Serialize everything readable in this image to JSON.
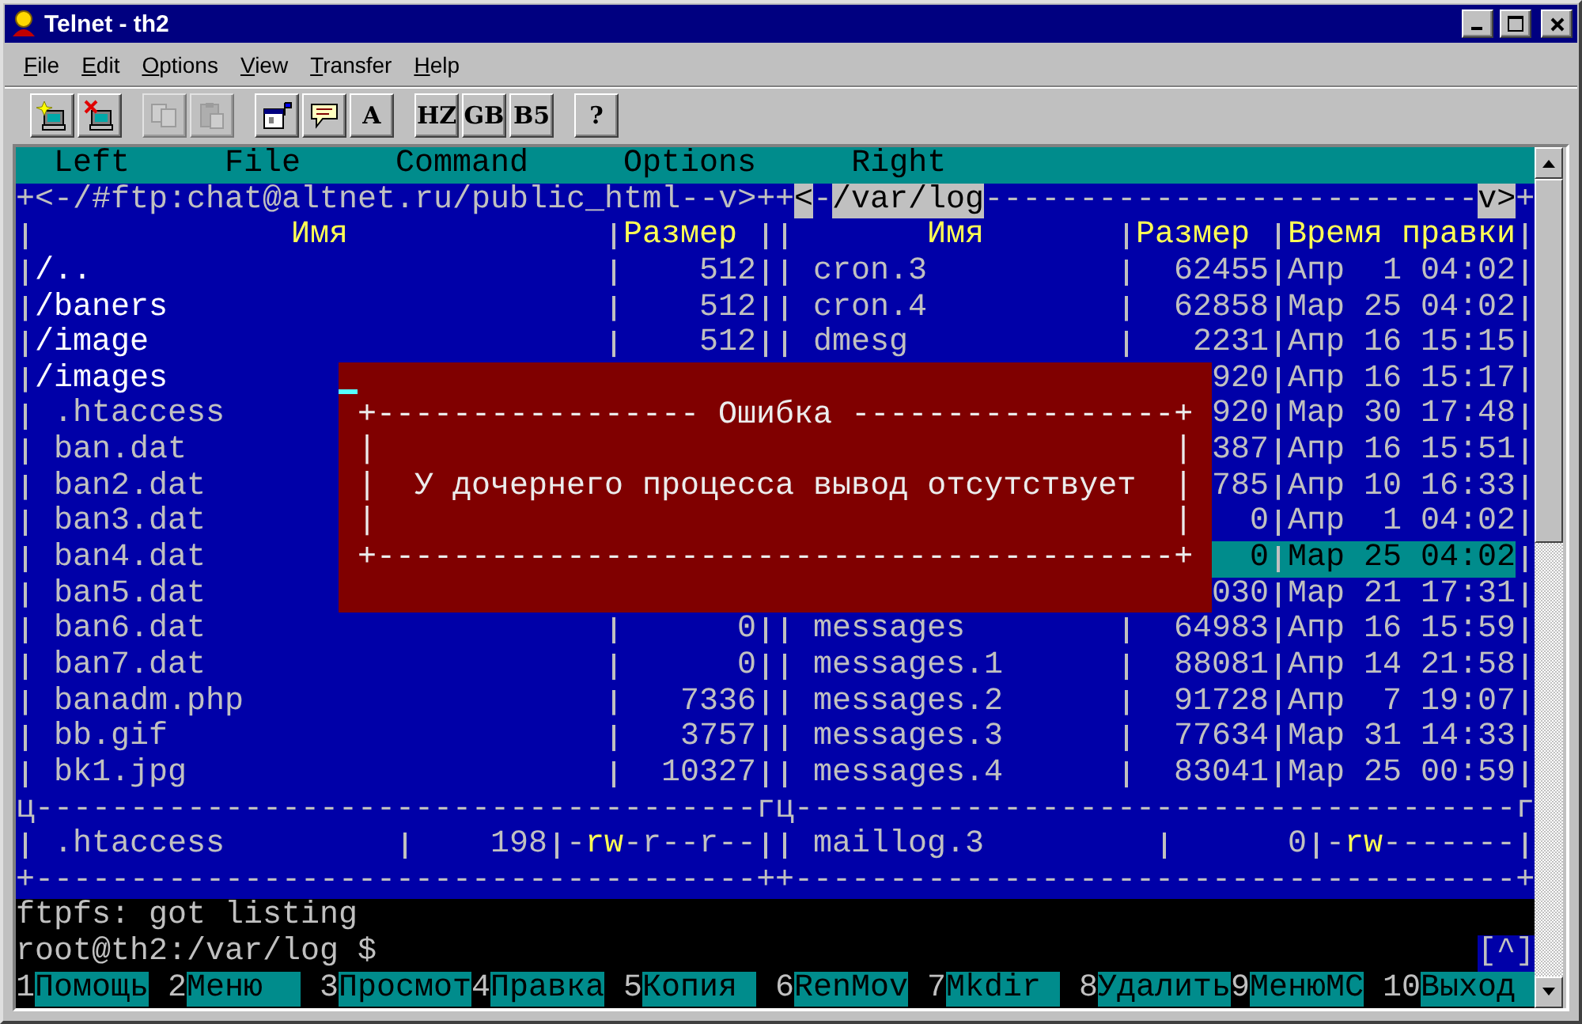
{
  "window": {
    "title": "Telnet - th2"
  },
  "menu": [
    "File",
    "Edit",
    "Options",
    "View",
    "Transfer",
    "Help"
  ],
  "toolbar": [
    [
      {
        "kind": "connect",
        "disabled": false
      },
      {
        "kind": "disconnect",
        "disabled": false
      }
    ],
    [
      {
        "kind": "copy",
        "disabled": true
      },
      {
        "kind": "paste",
        "disabled": true
      }
    ],
    [
      {
        "kind": "properties",
        "disabled": false
      },
      {
        "kind": "chat",
        "disabled": false
      },
      {
        "kind": "text",
        "label": "A",
        "disabled": false
      }
    ],
    [
      {
        "kind": "text",
        "label": "HZ",
        "disabled": false
      },
      {
        "kind": "text",
        "label": "GB",
        "disabled": false
      },
      {
        "kind": "text",
        "label": "B5",
        "disabled": false
      }
    ],
    [
      {
        "kind": "text",
        "label": "?",
        "disabled": false
      }
    ]
  ],
  "terminal": {
    "menu": [
      "Left",
      "File",
      "Command",
      "Options",
      "Right"
    ],
    "left_panel": {
      "top_border": [
        {
          "text": "+<-/#ftp:chat@altnet.ru/public_html--v>+",
          "highlighted": false
        }
      ],
      "columns": [
        "Имя",
        "Размер"
      ],
      "rows": [
        {
          "kind": "dir",
          "name": "/..",
          "size": "512",
          "selected": false
        },
        {
          "kind": "dir",
          "name": "/baners",
          "size": "512",
          "selected": false
        },
        {
          "kind": "dir",
          "name": "/image",
          "size": "512",
          "selected": false
        },
        {
          "kind": "dir",
          "name": "/images",
          "selected": false
        },
        {
          "kind": "file",
          "name": ".htaccess",
          "selected": false
        },
        {
          "kind": "file",
          "name": "ban.dat",
          "selected": false
        },
        {
          "kind": "file",
          "name": "ban2.dat",
          "selected": false
        },
        {
          "kind": "file",
          "name": "ban3.dat",
          "selected": false
        },
        {
          "kind": "file",
          "name": "ban4.dat",
          "selected": false
        },
        {
          "kind": "file",
          "name": "ban5.dat",
          "selected": false
        },
        {
          "kind": "file",
          "name": "ban6.dat",
          "size": "0",
          "selected": false
        },
        {
          "kind": "file",
          "name": "ban7.dat",
          "size": "0",
          "selected": false
        },
        {
          "kind": "file",
          "name": "banadm.php",
          "size": "7336",
          "selected": false
        },
        {
          "kind": "file",
          "name": "bb.gif",
          "size": "3757",
          "selected": false
        },
        {
          "kind": "file",
          "name": "bk1.jpg",
          "size": "10327",
          "selected": false
        }
      ],
      "separator": "ц--------------------------------------г",
      "status": {
        "name": ".htaccess",
        "size": "198",
        "permissions": [
          {
            "text": "-",
            "highlighted": false
          },
          {
            "text": "rw",
            "highlighted": true
          },
          {
            "text": "-r--r--",
            "highlighted": false
          }
        ]
      },
      "bottom_border": "+--------------------------------------+"
    },
    "right_panel": {
      "top_border": [
        {
          "text": "+",
          "highlighted": false
        },
        {
          "text": "<",
          "highlighted": true
        },
        {
          "text": "-",
          "highlighted": false
        },
        {
          "text": "/var/log",
          "highlighted": true
        },
        {
          "text": "--------------------------",
          "highlighted": false
        },
        {
          "text": "v>",
          "highlighted": true
        },
        {
          "text": "+",
          "highlighted": false
        }
      ],
      "columns": [
        "Имя",
        "Размер",
        "Время правки"
      ],
      "rows": [
        {
          "kind": "file",
          "name": "cron.3",
          "size": "62455",
          "date": "Апр  1 04:02",
          "selected": false
        },
        {
          "kind": "file",
          "name": "cron.4",
          "size": "62858",
          "date": "Мар 25 04:02",
          "selected": false
        },
        {
          "kind": "file",
          "name": "dmesg",
          "size": "2231",
          "date": "Апр 16 15:15",
          "selected": false
        },
        {
          "kind": "file",
          "size": "920",
          "date": "Апр 16 15:17",
          "selected": false
        },
        {
          "kind": "file",
          "size": "920",
          "date": "Мар 30 17:48",
          "selected": false
        },
        {
          "kind": "file",
          "size": "387",
          "date": "Апр 16 15:51",
          "selected": false
        },
        {
          "kind": "file",
          "size": "785",
          "date": "Апр 10 16:33",
          "selected": false
        },
        {
          "kind": "file",
          "size": "0",
          "date": "Апр  1 04:02",
          "selected": false
        },
        {
          "kind": "file",
          "size": "0",
          "date": "Мар 25 04:02",
          "selected": true
        },
        {
          "kind": "file",
          "size": "030",
          "date": "Мар 21 17:31",
          "selected": false
        },
        {
          "kind": "file",
          "name": "messages",
          "size": "64983",
          "date": "Апр 16 15:59",
          "selected": false
        },
        {
          "kind": "file",
          "name": "messages.1",
          "size": "88081",
          "date": "Апр 14 21:58",
          "selected": false
        },
        {
          "kind": "file",
          "name": "messages.2",
          "size": "91728",
          "date": "Апр  7 19:07",
          "selected": false
        },
        {
          "kind": "file",
          "name": "messages.3",
          "size": "77634",
          "date": "Мар 31 14:33",
          "selected": false
        },
        {
          "kind": "file",
          "name": "messages.4",
          "size": "83041",
          "date": "Мар 25 00:59",
          "selected": false
        }
      ],
      "separator": "ц--------------------------------------г",
      "status": {
        "name": "maillog.3",
        "size": "0",
        "permissions": [
          {
            "text": "-",
            "highlighted": false
          },
          {
            "text": "rw",
            "highlighted": true
          },
          {
            "text": "-------",
            "highlighted": false
          }
        ]
      },
      "bottom_border": "+--------------------------------------+"
    },
    "dialog": {
      "cursor": true,
      "top_border_left": "+-----------------",
      "title": "Ошибка",
      "top_border_right": "-----------------+",
      "lines": [
        {
          "left": "|",
          "right": "|"
        },
        {
          "left": "|",
          "message": "У дочернего процесса вывод отсутствует",
          "right": "|"
        },
        {
          "left": "|",
          "right": "|"
        }
      ],
      "bottom_border": "+------------------------------------------+"
    },
    "console": [
      {
        "text": "ftpfs: got listing"
      },
      {
        "text": "root@th2:/var/log $",
        "indicator": "[^]"
      }
    ],
    "function_keys": [
      {
        "number": "1",
        "label": "Помощь"
      },
      {
        "number": "2",
        "label": "Меню"
      },
      {
        "number": "3",
        "label": "Просмот"
      },
      {
        "number": "4",
        "label": "Правка"
      },
      {
        "number": "5",
        "label": "Копия"
      },
      {
        "number": "6",
        "label": "RenMov"
      },
      {
        "number": "7",
        "label": "Mkdir"
      },
      {
        "number": "8",
        "label": "Удалить"
      },
      {
        "number": "9",
        "label": "МенюMC"
      },
      {
        "number": "10",
        "label": "Выход"
      }
    ]
  }
}
